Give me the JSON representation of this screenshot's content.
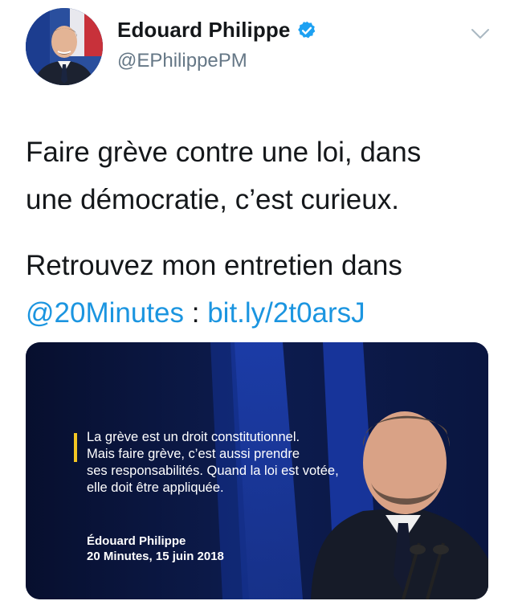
{
  "tweet": {
    "author_name": "Edouard Philippe",
    "author_handle": "@EPhilippePM",
    "text_line1": "Faire grève contre une loi, dans",
    "text_line2": "une démocratie, c’est curieux.",
    "text_line3": "Retrouvez mon entretien dans",
    "mention": "@20Minutes",
    "separator": " : ",
    "link": "bit.ly/2t0arsJ"
  },
  "media": {
    "quote_lines": [
      "La grève est un droit constitutionnel.",
      "Mais faire grève, c’est aussi prendre",
      "ses responsabilités. Quand la loi est votée,",
      "elle doit être appliquée."
    ],
    "attribution_name": "Édouard Philippe",
    "attribution_source": "20 Minutes, 15 juin 2018"
  },
  "icons": {
    "verified": "verified-badge-icon",
    "menu": "chevron-down-icon"
  },
  "colors": {
    "link": "#1b95e0",
    "handle": "#657786",
    "verified": "#1da1f2",
    "quote_bar": "#f3c623",
    "media_bg": "#0a1438"
  }
}
